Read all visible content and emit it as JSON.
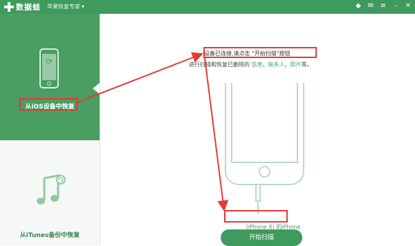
{
  "titlebar": {
    "app_name": "数据蛙",
    "product_menu": "苹果恢复专家",
    "icons": [
      "diamond-icon",
      "chat-icon",
      "menu-icon",
      "minimize-icon",
      "close-icon"
    ]
  },
  "sidebar": {
    "ios_label": "从iOS设备中恢复",
    "itunes_label": "从iTunes备份中恢复"
  },
  "main": {
    "message_line1": "设备已连接,请点击 \"开始扫描\"按钮",
    "message_line2_prefix": "进行扫描和恢复已删除的 ",
    "message_line2_items": [
      "信息",
      "联系人",
      "照片"
    ],
    "message_line2_suffix": "等。",
    "device_name": "(iPhone X) 的iPhone",
    "start_button": "开始扫描"
  },
  "colors": {
    "brand_green": "#3f9a5d",
    "highlight_red": "#e53935",
    "phone_outline": "#b7dcc3"
  }
}
